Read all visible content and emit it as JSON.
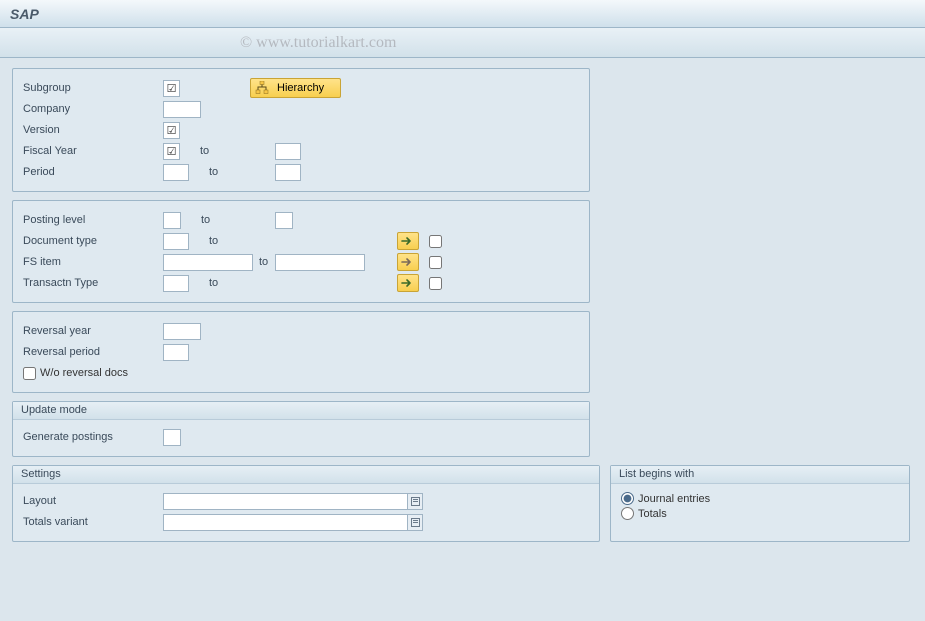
{
  "title": "SAP",
  "watermark": "© www.tutorialkart.com",
  "group1": {
    "subgroup_label": "Subgroup",
    "subgroup_checked": "☑",
    "hierarchy_label": "Hierarchy",
    "company_label": "Company",
    "version_label": "Version",
    "version_checked": "☑",
    "fiscal_year_label": "Fiscal Year",
    "fiscal_year_checked": "☑",
    "fiscal_year_to": "to",
    "period_label": "Period",
    "period_to": "to"
  },
  "group2": {
    "posting_level_label": "Posting level",
    "posting_level_to": "to",
    "document_type_label": "Document type",
    "document_type_to": "to",
    "fs_item_label": "FS item",
    "fs_item_to": "to",
    "transactn_type_label": "Transactn Type",
    "transactn_type_to": "to"
  },
  "group3": {
    "reversal_year_label": "Reversal year",
    "reversal_period_label": "Reversal period",
    "wo_reversal_label": "W/o reversal docs"
  },
  "group4": {
    "title": "Update mode",
    "generate_postings_label": "Generate postings"
  },
  "settings": {
    "title": "Settings",
    "layout_label": "Layout",
    "totals_variant_label": "Totals variant"
  },
  "list": {
    "title": "List begins with",
    "journal_label": "Journal entries",
    "totals_label": "Totals"
  }
}
